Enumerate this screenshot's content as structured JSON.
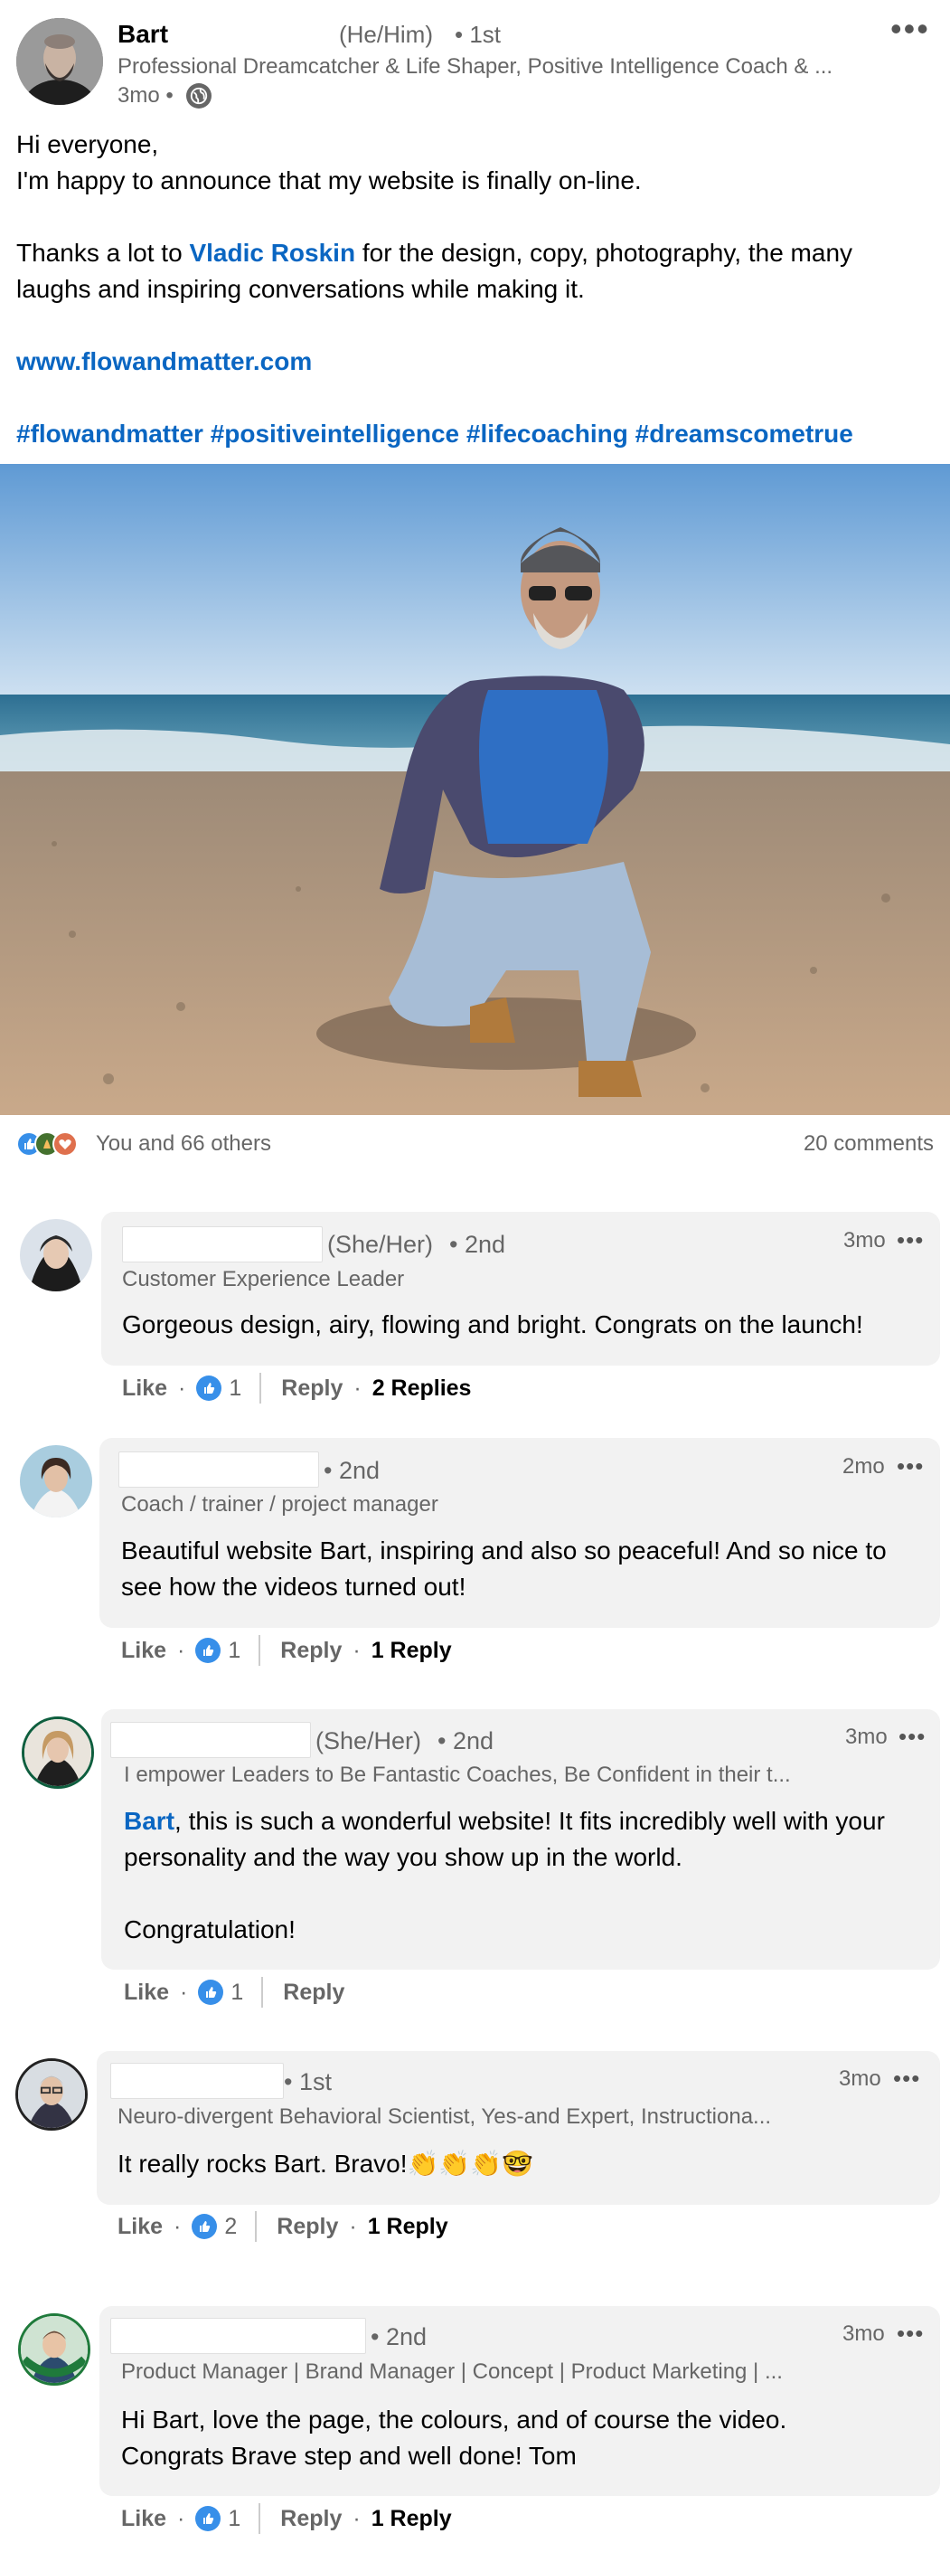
{
  "post": {
    "author_name": "Bart",
    "author_pronouns": "(He/Him)",
    "author_degree": "• 1st",
    "author_headline": "Professional Dreamcatcher & Life Shaper, Positive Intelligence Coach & ...",
    "time": "3mo •",
    "paragraphs": [
      "Hi everyone,",
      "I'm happy to announce that my website is finally on-line."
    ],
    "thanks_before": "Thanks a lot to ",
    "thanks_mention": "Vladic Roskin",
    "thanks_after": " for the design, copy, photography, the many laughs and inspiring conversations while making it.",
    "website": "www.flowandmatter.com",
    "hashtags": "#flowandmatter #positiveintelligence #lifecoaching #dreamscometrue",
    "reactions_text": "You and 66 others",
    "comments_count": "20 comments"
  },
  "icons": {
    "more": "more-icon",
    "globe": "globe-icon",
    "like": "like-icon"
  },
  "colors": {
    "link": "#0a66c2",
    "like": "#378fe9",
    "bubble": "#f2f2f2"
  },
  "comments": [
    {
      "pronouns": "(She/Her)",
      "degree": "• 2nd",
      "headline": "Customer Experience Leader",
      "time": "3mo",
      "text": "Gorgeous design, airy, flowing and bright. Congrats on the launch!",
      "like_label": "Like",
      "like_count": "1",
      "reply_label": "Reply",
      "replies": "2 Replies"
    },
    {
      "pronouns": "",
      "degree": "• 2nd",
      "headline": "Coach / trainer / project manager",
      "time": "2mo",
      "text": "Beautiful website Bart, inspiring and also so peaceful! And so nice to see how the videos turned out!",
      "like_label": "Like",
      "like_count": "1",
      "reply_label": "Reply",
      "replies": "1 Reply"
    },
    {
      "pronouns": "(She/Her)",
      "degree": "• 2nd",
      "headline": "I empower Leaders to Be Fantastic Coaches, Be Confident in their t...",
      "time": "3mo",
      "mention": "Bart",
      "text": ", this is such a wonderful website! It fits incredibly well with your personality and the way you show up in the world.",
      "text2": "Congratulation!",
      "like_label": "Like",
      "like_count": "1",
      "reply_label": "Reply",
      "replies": ""
    },
    {
      "pronouns": "",
      "degree": "• 1st",
      "headline": "Neuro-divergent Behavioral Scientist, Yes-and Expert, Instructiona...",
      "time": "3mo",
      "text": "It really rocks Bart. Bravo!👏👏👏🤓",
      "like_label": "Like",
      "like_count": "2",
      "reply_label": "Reply",
      "replies": "1 Reply"
    },
    {
      "pronouns": "",
      "degree": "• 2nd",
      "headline": "Product Manager | Brand Manager | Concept | Product Marketing | ...",
      "time": "3mo",
      "text": "Hi Bart, love the page, the colours, and of course the video.",
      "text2": "Congrats Brave step and well done! Tom",
      "like_label": "Like",
      "like_count": "1",
      "reply_label": "Reply",
      "replies": "1 Reply"
    }
  ]
}
